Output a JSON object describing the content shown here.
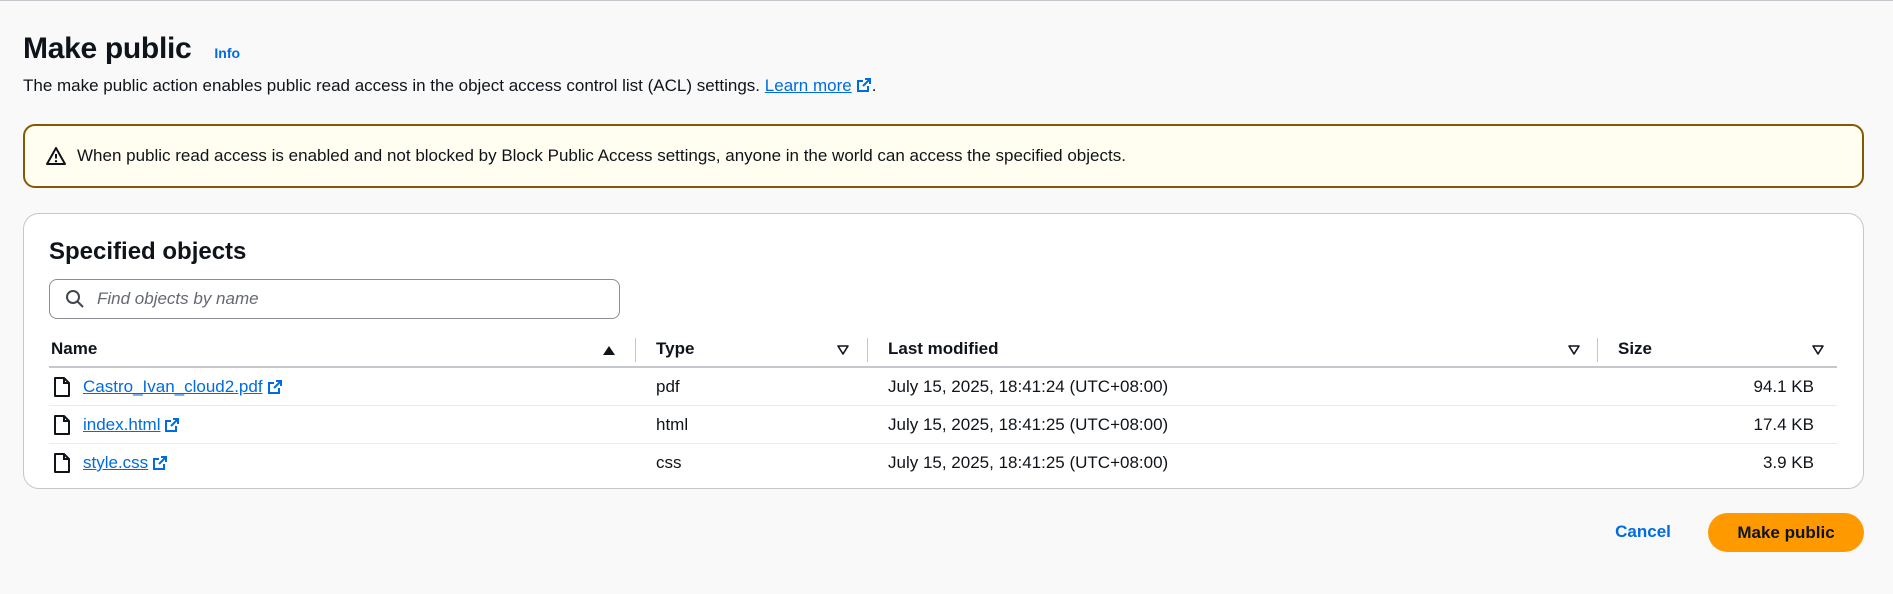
{
  "header": {
    "title": "Make public",
    "info_label": "Info",
    "description": "The make public action enables public read access in the object access control list (ACL) settings.",
    "learn_more_label": "Learn more",
    "description_end": "."
  },
  "alert": {
    "text": "When public read access is enabled and not blocked by Block Public Access settings, anyone in the world can access the specified objects.",
    "icon": "warning-icon"
  },
  "objects": {
    "title": "Specified objects",
    "search_placeholder": "Find objects by name",
    "search_value": "",
    "columns": {
      "name": "Name",
      "type": "Type",
      "last_modified": "Last modified",
      "size": "Size"
    },
    "rows": [
      {
        "name": "Castro_Ivan_cloud2.pdf",
        "type": "pdf",
        "last_modified": "July 15, 2025, 18:41:24 (UTC+08:00)",
        "size": "94.1 KB"
      },
      {
        "name": "index.html",
        "type": "html",
        "last_modified": "July 15, 2025, 18:41:25 (UTC+08:00)",
        "size": "17.4 KB"
      },
      {
        "name": "style.css",
        "type": "css",
        "last_modified": "July 15, 2025, 18:41:25 (UTC+08:00)",
        "size": "3.9 KB"
      }
    ]
  },
  "actions": {
    "cancel_label": "Cancel",
    "submit_label": "Make public"
  },
  "colors": {
    "accent": "#006ce0",
    "primary_button": "#ff9900",
    "warning_border": "#855900",
    "warning_bg": "#fffef0"
  }
}
